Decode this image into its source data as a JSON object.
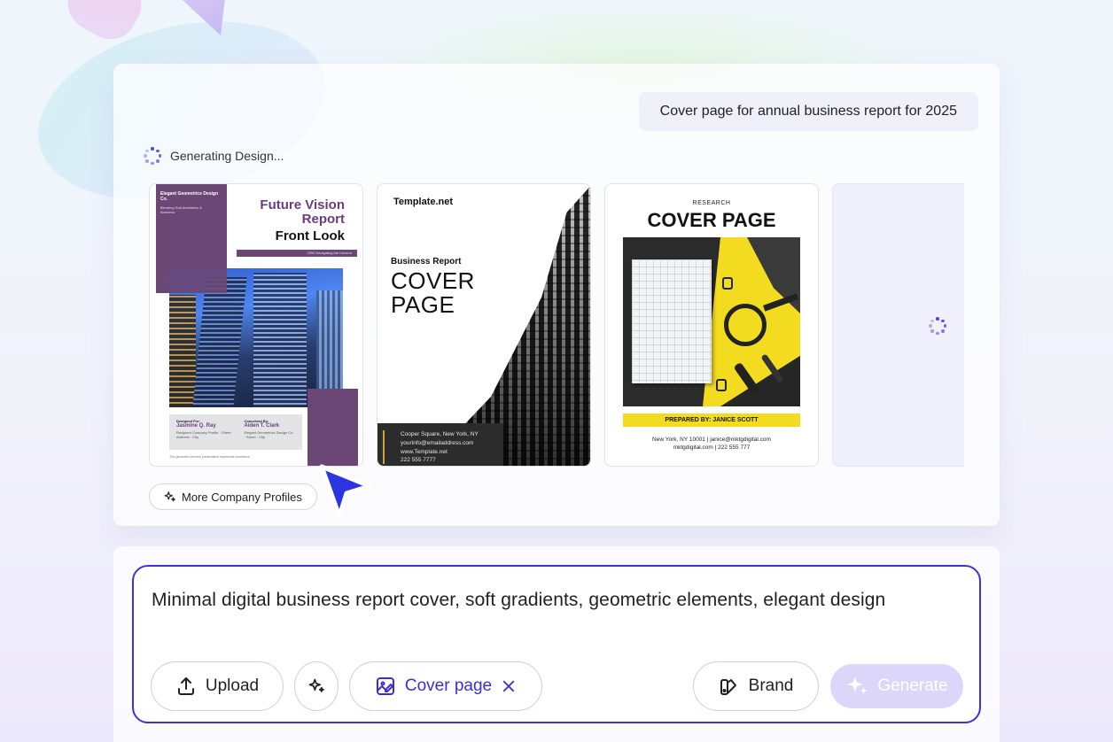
{
  "prompt_bubble": "Cover page for annual business report for 2025",
  "status": {
    "text": "Generating Design..."
  },
  "cards": {
    "card1": {
      "company": "Elegant Geometrics Design Co.",
      "company_sub": "Blending Soft Aesthetics & Business",
      "title_line1": "Future Vision",
      "title_line2": "Report",
      "title_line3": "Front Look",
      "strip": "2050 Navigating the Horizon",
      "designed_for_label": "Designed For:",
      "designed_for_name": "Jasmine Q. Ray",
      "designed_for_detail": "Recipient Company Profile · Street Address · City",
      "conceived_by_label": "Conceived By:",
      "conceived_by_name": "Aiden T. Clark",
      "conceived_by_detail": "Elegant Geometrics Design Co. · Street · City",
      "footer": "This geometric-themed presentation represents excellence"
    },
    "card2": {
      "brand": "Template.net",
      "small_title": "Business Report",
      "big_title_1": "COVER",
      "big_title_2": "PAGE",
      "addr1": "Cooper Square, New York, NY",
      "addr2": "yourinfo@emailaddress.com",
      "addr3": "www.Template.net",
      "addr4": "222 555 7777"
    },
    "card3": {
      "eyebrow": "RESEARCH",
      "title": "COVER PAGE",
      "prepared": "PREPARED BY: JANICE SCOTT",
      "contact1": "New York, NY 10001 | janice@mktgdigital.com",
      "contact2": "mktgdigital.com | 222 555 777"
    }
  },
  "more_button": "More Company Profiles",
  "composer": {
    "text": "Minimal digital business report cover, soft gradients, geometric elements, elegant design",
    "upload_label": "Upload",
    "cover_label": "Cover page",
    "brand_label": "Brand",
    "generate_label": "Generate"
  },
  "colors": {
    "accent": "#3b32d8",
    "purple": "#6b4775",
    "yellow": "#f3dc1f",
    "generate_disabled": "#dcd6fb"
  },
  "icons": [
    "spinner-icon",
    "sparkles-icon",
    "upload-icon",
    "magic-icon",
    "image-edit-icon",
    "close-icon",
    "brand-icon",
    "cursor-icon"
  ]
}
